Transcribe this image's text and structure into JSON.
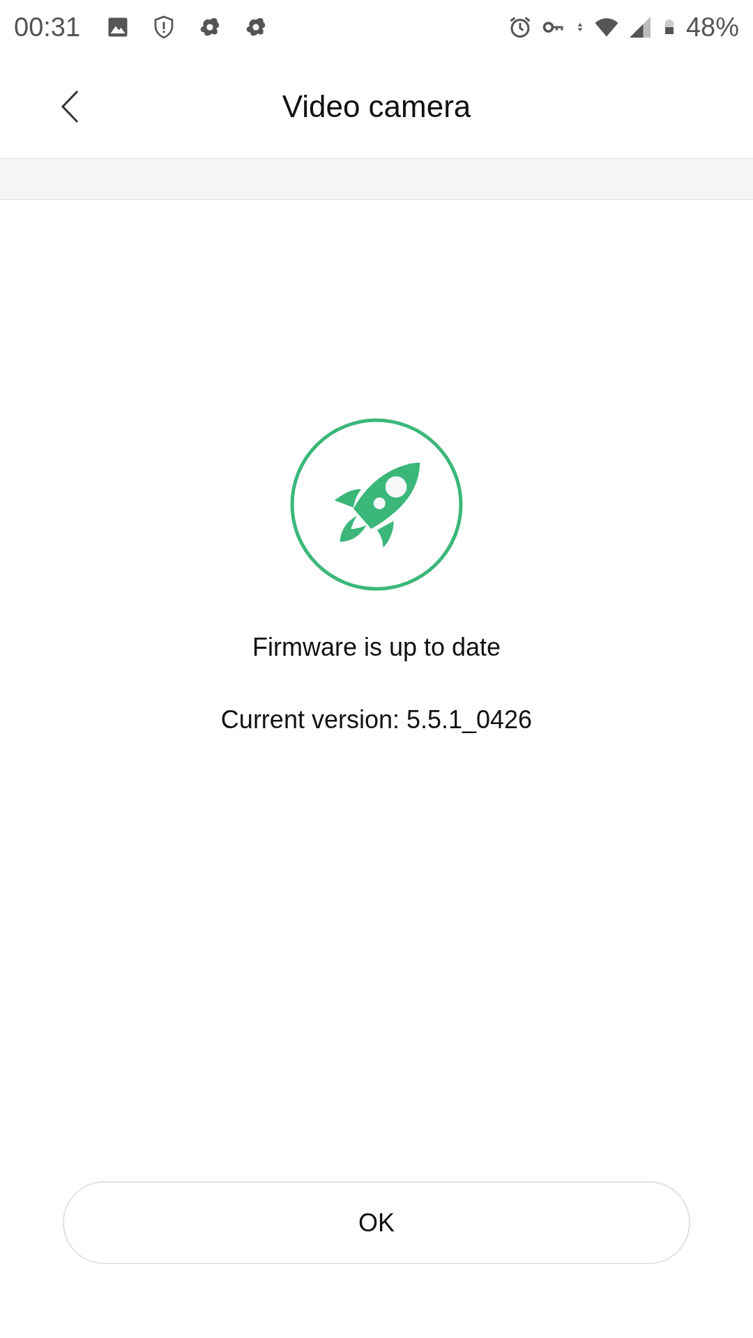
{
  "status_bar": {
    "time": "00:31",
    "battery": "48%"
  },
  "header": {
    "title": "Video camera"
  },
  "message": {
    "title": "Firmware is up to date",
    "version": "Current version: 5.5.1_0426"
  },
  "buttons": [
    "OK"
  ]
}
